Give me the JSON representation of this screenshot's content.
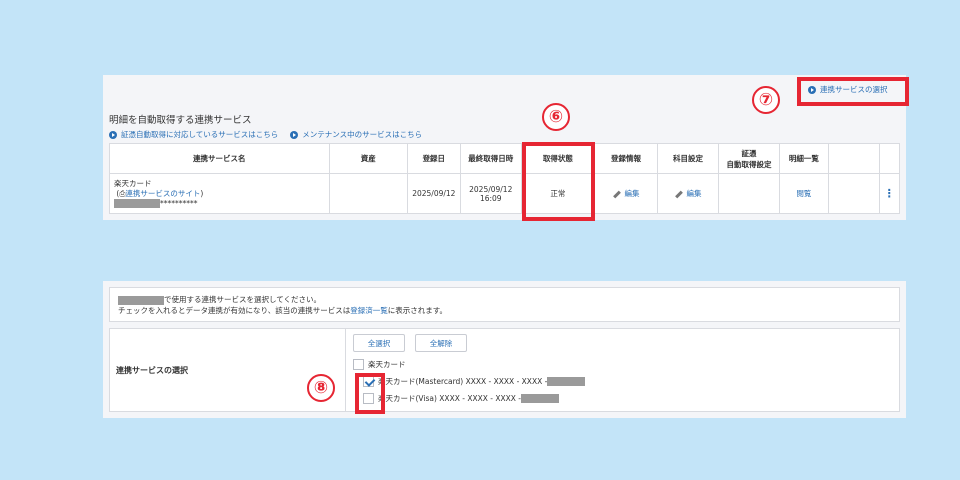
{
  "top_panel": {
    "title": "明細を自動取得する連携サービス",
    "links": [
      "証憑自動取得に対応しているサービスはこちら",
      "メンテナンス中のサービスはこちら"
    ],
    "select_service_link": "連携サービスの選択",
    "columns": [
      "連携サービス名",
      "資産",
      "登録日",
      "最終取得日時",
      "取得状態",
      "登録情報",
      "科目設定",
      "証憑",
      "自動取得設定",
      "明細一覧"
    ],
    "row": {
      "name": "楽天カード",
      "site_prefix": "(",
      "site_link": "連携サービスのサイト",
      "site_suffix": ")",
      "account_mask": "**********",
      "registered": "2025/09/12",
      "last_date": "2025/09/12",
      "last_time": "16:09",
      "status": "正常",
      "edit_label": "編集",
      "view_label": "閲覧",
      "menu": "⋮"
    }
  },
  "bottom_panel": {
    "info_line1": "で使用する連携サービスを選択してください。",
    "info_line2_a": "チェックを入れるとデータ連携が有効になり、該当の連携サービスは",
    "info_line2_link": "登録済一覧",
    "info_line2_b": "に表示されます。",
    "section_label": "連携サービスの選択",
    "select_all": "全選択",
    "deselect_all": "全解除",
    "checkboxes": [
      {
        "label": "楽天カード",
        "checked": false
      },
      {
        "label": "楽天カード(Mastercard) XXXX - XXXX - XXXX - ",
        "checked": true
      },
      {
        "label": "楽天カード(Visa) XXXX - XXXX - XXXX - ",
        "checked": false
      }
    ]
  },
  "annotations": {
    "six": "⑥",
    "seven": "⑦",
    "eight": "⑧"
  },
  "colors": {
    "background": "#c3e4f8",
    "accent": "#2a6fb5",
    "highlight": "#e62633"
  }
}
